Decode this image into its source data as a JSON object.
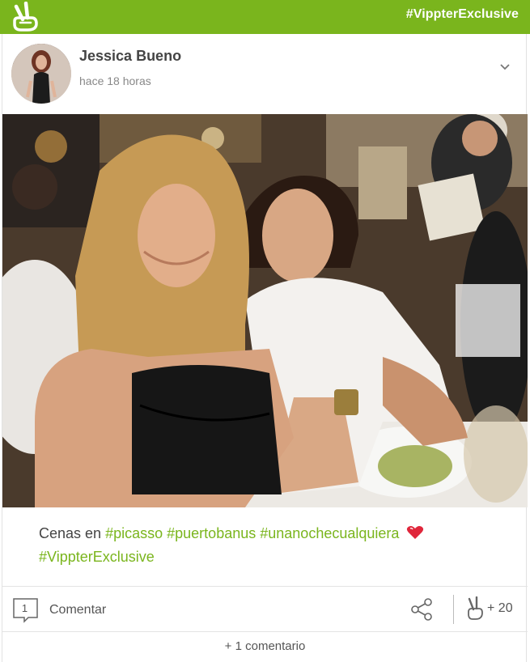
{
  "header": {
    "logo_icon": "victory-hand-logo-icon",
    "hashtag": "#VippterExclusive",
    "bar_color": "#7ab51d"
  },
  "post": {
    "author": "Jessica Bueno",
    "time": "hace 18 horas",
    "menu_icon": "chevron-down-icon",
    "caption_prefix": "Cenas en",
    "hashtags": [
      "#picasso",
      "#puertobanus",
      "#unanochecualquiera",
      "#VippterExclusive"
    ],
    "emoji_icon": "heart-icon",
    "hashtag_color": "#7ab51d"
  },
  "actions": {
    "comment_count": "1",
    "comment_label": "Comentar",
    "share_icon": "share-icon",
    "vote_icon": "victory-hand-icon",
    "vote_count": "+ 20"
  },
  "footer": {
    "more_comments": "+ 1 comentario"
  }
}
